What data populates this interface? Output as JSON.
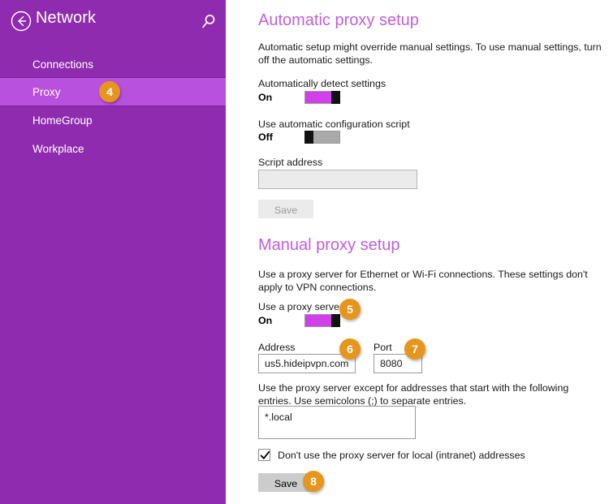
{
  "sidebar": {
    "title": "Network",
    "back_icon": "back-arrow-circle-icon",
    "search_icon": "search-icon",
    "items": [
      {
        "label": "Connections",
        "selected": false
      },
      {
        "label": "Proxy",
        "selected": true
      },
      {
        "label": "HomeGroup",
        "selected": false
      },
      {
        "label": "Workplace",
        "selected": false
      }
    ]
  },
  "badges": [
    {
      "number": "4"
    },
    {
      "number": "5"
    },
    {
      "number": "6"
    },
    {
      "number": "7"
    },
    {
      "number": "8"
    }
  ],
  "automatic": {
    "heading": "Automatic proxy setup",
    "description": "Automatic setup might override manual settings. To use manual settings, turn off the automatic settings.",
    "detect_label": "Automatically detect settings",
    "detect_state": "On",
    "script_toggle_label": "Use automatic configuration script",
    "script_toggle_state": "Off",
    "script_address_label": "Script address",
    "script_address_value": "",
    "script_address_placeholder": "",
    "save_label": "Save"
  },
  "manual": {
    "heading": "Manual proxy setup",
    "description": "Use a proxy server for Ethernet or Wi-Fi connections. These settings don't apply to VPN connections.",
    "use_proxy_label": "Use a proxy server",
    "use_proxy_state": "On",
    "address_label": "Address",
    "address_value": "us5.hideipvpn.com",
    "port_label": "Port",
    "port_value": "8080",
    "exceptions_description": "Use the proxy server except for addresses that start with the following entries. Use semicolons (;) to separate entries.",
    "exceptions_value": "*.local",
    "checkbox_label": "Don't use the proxy server for local (intranet) addresses",
    "checkbox_checked": true,
    "save_label": "Save"
  },
  "colors": {
    "sidebar_bg": "#8E2BAF",
    "sidebar_selected": "#B851DE",
    "heading": "#C45DDE",
    "badge": "#E8951E",
    "toggle_on": "#D13FE8",
    "toggle_off": "#A9A9A9"
  }
}
